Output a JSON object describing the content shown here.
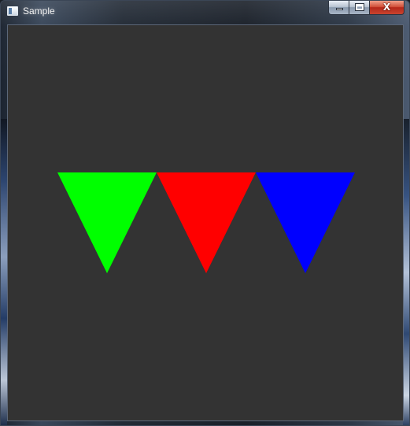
{
  "window": {
    "title": "Sample",
    "close_glyph": "X",
    "minimize_icon": "minimize-icon",
    "maximize_icon": "maximize-icon",
    "close_icon": "close-icon"
  },
  "canvas": {
    "background_color": "#333333",
    "triangles": [
      {
        "name": "green-triangle",
        "color": "#00ff00",
        "orientation": "pointing-down"
      },
      {
        "name": "red-triangle",
        "color": "#ff0000",
        "orientation": "pointing-down"
      },
      {
        "name": "blue-triangle",
        "color": "#0000ff",
        "orientation": "pointing-down"
      }
    ]
  }
}
